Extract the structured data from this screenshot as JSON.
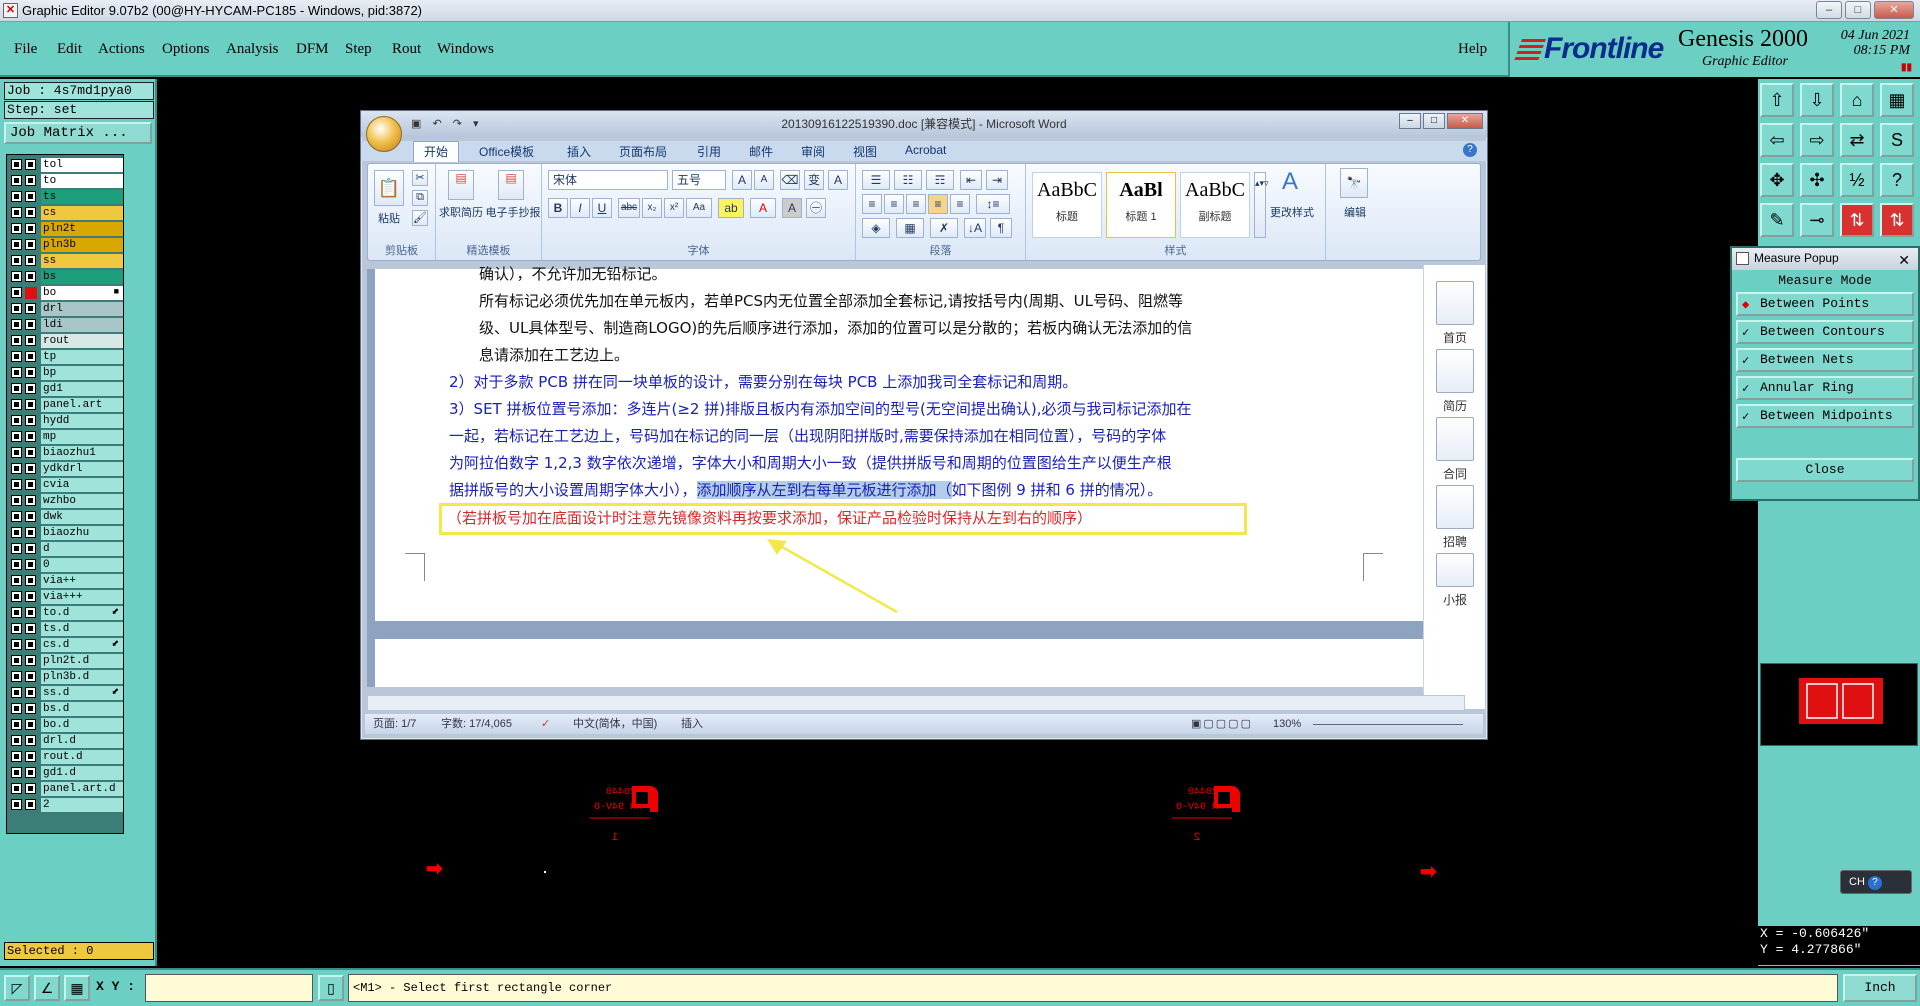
{
  "window": {
    "title": "Graphic Editor 9.07b2 (00@HY-HYCAM-PC185 - Windows, pid:3872)",
    "controls": [
      "–",
      "□",
      "✕"
    ]
  },
  "menu": {
    "items": [
      "File",
      "Edit",
      "Actions",
      "Options",
      "Analysis",
      "DFM",
      "Step",
      "Rout",
      "Windows"
    ],
    "help": "Help"
  },
  "brand": {
    "frontline": "Frontline",
    "product": "Genesis 2000",
    "subtitle": "Graphic Editor",
    "date": "04 Jun 2021",
    "time": "08:15 PM"
  },
  "job": {
    "job_line": "Job : 4s7md1pya0",
    "step_line": "Step: set",
    "job_matrix": "Job Matrix ..."
  },
  "layers": [
    {
      "name": "tol",
      "color": "#ffffff"
    },
    {
      "name": "to",
      "color": "#ffffff"
    },
    {
      "name": "ts",
      "color": "#1c9f7a"
    },
    {
      "name": "cs",
      "color": "#f0c840"
    },
    {
      "name": "pln2t",
      "color": "#d9a800"
    },
    {
      "name": "pln3b",
      "color": "#d9a800"
    },
    {
      "name": "ss",
      "color": "#f0c840"
    },
    {
      "name": "bs",
      "color": "#1c9f7a"
    },
    {
      "name": "bo",
      "color": "#ffffff",
      "active": true
    },
    {
      "name": "drl",
      "color": "#a8c6c8"
    },
    {
      "name": "ldi",
      "color": "#a8c6c8"
    },
    {
      "name": "rout",
      "color": "#d8e8e4"
    },
    {
      "name": "tp",
      "color": "#9fe3da"
    },
    {
      "name": "bp",
      "color": "#9fe3da"
    },
    {
      "name": "gd1",
      "color": "#9fe3da"
    },
    {
      "name": "panel.art",
      "color": "#9fe3da"
    },
    {
      "name": "hydd",
      "color": "#9fe3da"
    },
    {
      "name": "mp",
      "color": "#9fe3da"
    },
    {
      "name": "biaozhu1",
      "color": "#9fe3da"
    },
    {
      "name": "ydkdrl",
      "color": "#9fe3da"
    },
    {
      "name": "cvia",
      "color": "#9fe3da"
    },
    {
      "name": "wzhbo",
      "color": "#9fe3da"
    },
    {
      "name": "dwk",
      "color": "#9fe3da"
    },
    {
      "name": "biaozhu",
      "color": "#9fe3da"
    },
    {
      "name": "d",
      "color": "#9fe3da"
    },
    {
      "name": "0",
      "color": "#9fe3da"
    },
    {
      "name": "via++",
      "color": "#9fe3da"
    },
    {
      "name": "via+++",
      "color": "#9fe3da"
    },
    {
      "name": "to.d",
      "color": "#9fe3da",
      "flag": "⬋"
    },
    {
      "name": "ts.d",
      "color": "#9fe3da"
    },
    {
      "name": "cs.d",
      "color": "#9fe3da",
      "flag": "⬋"
    },
    {
      "name": "pln2t.d",
      "color": "#9fe3da"
    },
    {
      "name": "pln3b.d",
      "color": "#9fe3da"
    },
    {
      "name": "ss.d",
      "color": "#9fe3da",
      "flag": "⬋"
    },
    {
      "name": "bs.d",
      "color": "#9fe3da"
    },
    {
      "name": "bo.d",
      "color": "#9fe3da"
    },
    {
      "name": "drl.d",
      "color": "#9fe3da"
    },
    {
      "name": "rout.d",
      "color": "#9fe3da"
    },
    {
      "name": "gd1.d",
      "color": "#9fe3da"
    },
    {
      "name": "panel.art.d",
      "color": "#9fe3da"
    },
    {
      "name": "2",
      "color": "#9fe3da"
    }
  ],
  "selected": "Selected : 0",
  "measure_popup": {
    "title": "Measure Popup",
    "mode_label": "Measure Mode",
    "options": [
      "Between Points",
      "Between Contours",
      "Between Nets",
      "Annular Ring",
      "Between Midpoints"
    ],
    "close": "Close"
  },
  "coords": {
    "x": "X = -0.606426\"",
    "y": "Y = 4.277866\""
  },
  "ch_pill": "CH",
  "bottom": {
    "xy_label": "X Y :",
    "message": "<M1> - Select first rectangle corner",
    "units": "Inch"
  },
  "pcb_marks": {
    "left_text": "E20440\nMH 94V-0",
    "left_num": "1",
    "right_num": "2"
  },
  "word": {
    "title": "20130916122519390.doc [兼容模式] - Microsoft Word",
    "tabs": [
      "开始",
      "Office模板",
      "插入",
      "页面布局",
      "引用",
      "邮件",
      "审阅",
      "视图",
      "Acrobat"
    ],
    "groups": [
      "剪贴板",
      "精选模板",
      "字体",
      "段落",
      "样式"
    ],
    "paste": "粘贴",
    "templates": [
      "求职简历",
      "电子手抄报"
    ],
    "font_name": "宋体",
    "font_size": "五号",
    "styles": [
      {
        "preview": "AaBbC",
        "name": "标题"
      },
      {
        "preview": "AaBl",
        "name": "标题 1"
      },
      {
        "preview": "AaBbC",
        "name": "副标题"
      }
    ],
    "change_style": "更改样式",
    "edit": "编辑",
    "body": {
      "line0": "确认），不允许加无铅标记。",
      "line1": "所有标记必须优先加在单元板内，若单PCS内无位置全部添加全套标记,请按括号内(周期、UL号码、阻燃等",
      "line2": "级、UL具体型号、制造商LOGO)的先后顺序进行添加，添加的位置可以是分散的；若板内确认无法添加的信",
      "line3": "息请添加在工艺边上。",
      "line4": "2）对于多款 PCB 拼在同一块单板的设计，需要分别在每块 PCB 上添加我司全套标记和周期。",
      "line5": "3）SET 拼板位置号添加：多连片(≥2 拼)排版且板内有添加空间的型号(无空间提出确认),必须与我司标记添加在",
      "line6": "一起，若标记在工艺边上，号码加在标记的同一层（出现阴阳拼版时,需要保持添加在相同位置），号码的字体",
      "line7": "为阿拉伯数字 1,2,3 数字依次递增，字体大小和周期大小一致（提供拼版号和周期的位置图给生产以便生产根",
      "line8a": "据拼版号的大小设置周期字体大小），",
      "line8b": "添加顺序从左到右每单元板进行添加（",
      "line8c": "如下图例 9 拼和 6 拼的情况）。",
      "note": "（若拼板号加在底面设计时注意先镜像资料再按要求添加，保证产品检验时保持从左到右的顺序）"
    },
    "right_pane": [
      "首页",
      "简历",
      "合同",
      "招聘",
      "小报"
    ],
    "status": {
      "page": "页面: 1/7",
      "words": "字数: 17/4,065",
      "lang": "中文(简体，中国)",
      "mode": "插入",
      "zoom": "130%"
    }
  }
}
